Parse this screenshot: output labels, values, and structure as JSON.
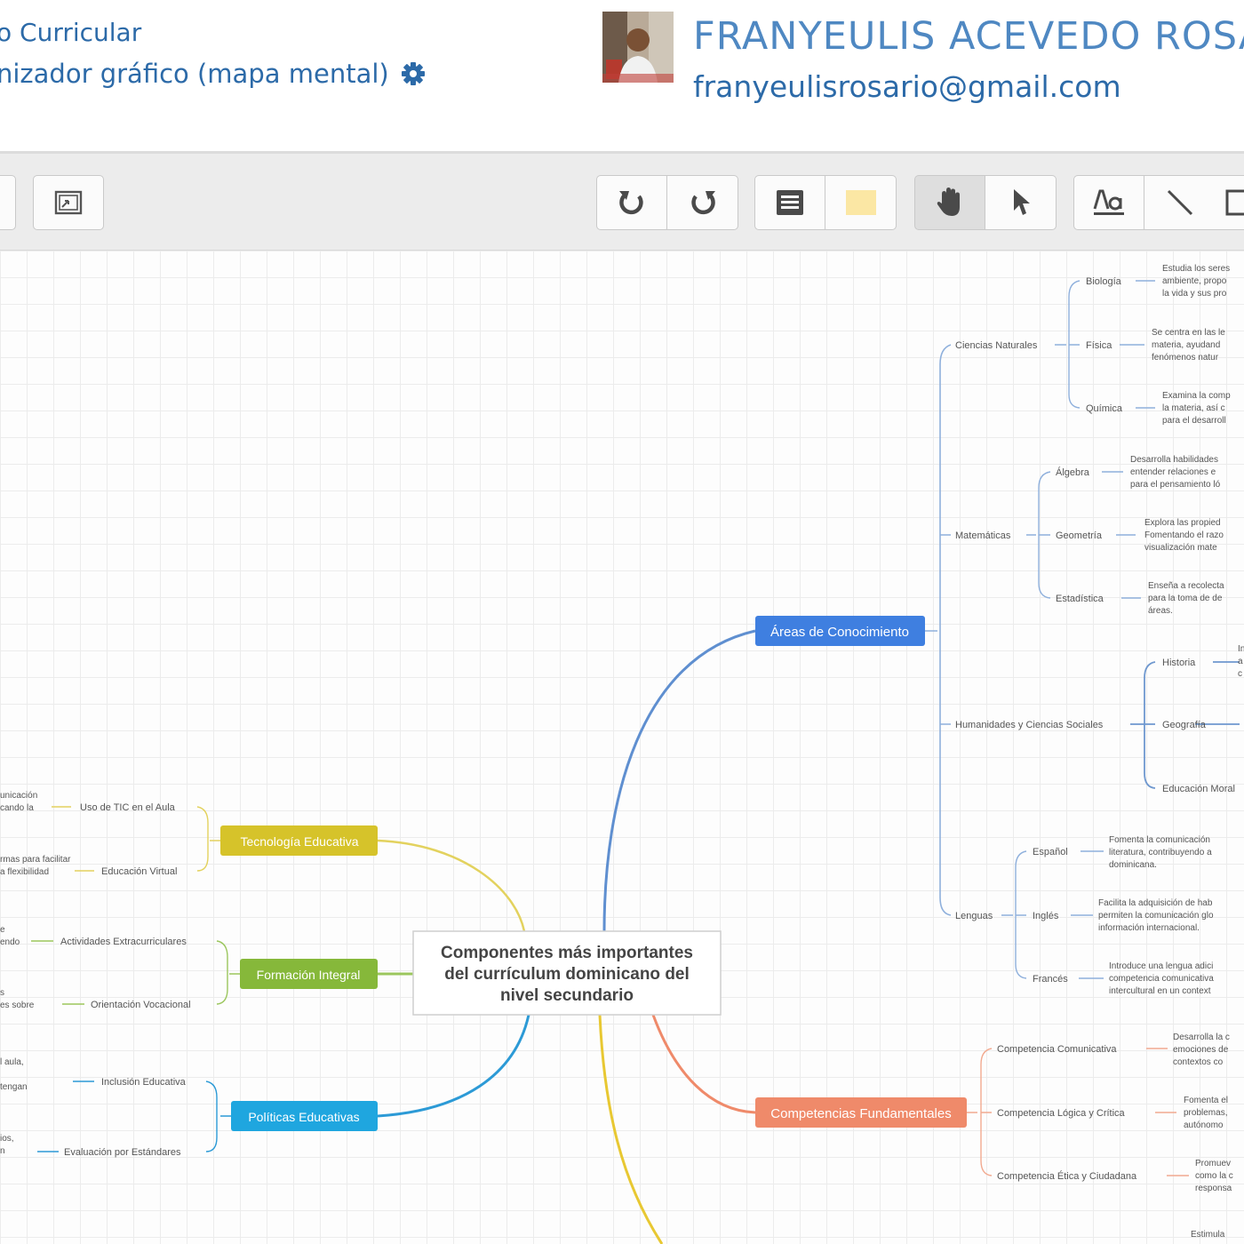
{
  "header": {
    "breadcrumb": "o Curricular",
    "activity_title": "nizador gráfico (mapa mental)",
    "user_name": "FRANYEULIS ACEVEDO ROSARIO",
    "user_email": "franyeulisrosario@gmail.com",
    "settings_icon": "gear-icon",
    "avatar_icon": "user-photo"
  },
  "toolbar": {
    "buttons": [
      {
        "icon": "collapse-icon"
      },
      {
        "icon": "fit-screen-icon"
      },
      {
        "icon": "undo-icon"
      },
      {
        "icon": "redo-icon"
      },
      {
        "icon": "note-icon"
      },
      {
        "icon": "color-fill-icon"
      },
      {
        "icon": "hand-pan-icon",
        "active": true
      },
      {
        "icon": "pointer-icon"
      },
      {
        "icon": "text-icon"
      },
      {
        "icon": "line-icon"
      },
      {
        "icon": "rectangle-icon"
      }
    ]
  },
  "mindmap": {
    "central": [
      "Componentes más importantes",
      "del currículum dominicano del",
      "nivel secundario"
    ],
    "colors": {
      "areas": "#3f7fe0",
      "competencias": "#ef8a6a",
      "tecnologia": "#d6c32a",
      "formacion": "#86b83a",
      "politicas": "#1fa6df"
    },
    "areas": {
      "label": "Áreas de Conocimiento",
      "ciencias": {
        "label": "Ciencias Naturales",
        "items": [
          {
            "label": "Biología",
            "desc": [
              "Estudia los seres",
              "ambiente, propo",
              "la vida y sus pro"
            ]
          },
          {
            "label": "Física",
            "desc": [
              "Se centra en las le",
              "materia, ayudand",
              "fenómenos natur"
            ]
          },
          {
            "label": "Química",
            "desc": [
              "Examina la comp",
              "la materia, así c",
              "para el desarroll"
            ]
          }
        ]
      },
      "matematicas": {
        "label": "Matemáticas",
        "items": [
          {
            "label": "Álgebra",
            "desc": [
              "Desarrolla habilidades",
              "entender relaciones e",
              "para el pensamiento ló"
            ]
          },
          {
            "label": "Geometría",
            "desc": [
              "Explora las propied",
              "Fomentando el razo",
              "visualización mate"
            ]
          },
          {
            "label": "Estadística",
            "desc": [
              "Enseña a recolecta",
              "para la toma de de",
              "áreas."
            ]
          }
        ]
      },
      "humanidades": {
        "label": "Humanidades y Ciencias Sociales",
        "items": [
          {
            "label": "Historia",
            "desc": [
              "In",
              "a",
              "c"
            ]
          },
          {
            "label": "Geografía",
            "desc": []
          },
          {
            "label": "Educación Moral",
            "desc": []
          }
        ]
      },
      "lenguas": {
        "label": "Lenguas",
        "items": [
          {
            "label": "Español",
            "desc": [
              "Fomenta la comunicación",
              "literatura, contribuyendo a",
              "dominicana."
            ]
          },
          {
            "label": "Inglés",
            "desc": [
              "Facilita la adquisición de hab",
              "permiten la comunicación glo",
              "información internacional."
            ]
          },
          {
            "label": "Francés",
            "desc": [
              "Introduce una lengua adici",
              "competencia comunicativa",
              "intercultural en un context"
            ]
          }
        ]
      }
    },
    "competencias": {
      "label": "Competencias Fundamentales",
      "items": [
        {
          "label": "Competencia Comunicativa",
          "desc": [
            "Desarrolla la c",
            "emociones de",
            "contextos co"
          ]
        },
        {
          "label": "Competencia Lógica y Crítica",
          "desc": [
            "Fomenta el",
            "problemas,",
            "autónomo"
          ]
        },
        {
          "label": "Competencia Ética y Ciudadana",
          "desc": [
            "Promuev",
            "como la c",
            "responsa"
          ]
        },
        {
          "label": "",
          "desc": [
            "Estimula"
          ]
        }
      ]
    },
    "tecnologia": {
      "label": "Tecnología Educativa",
      "items": [
        {
          "label": "Uso de TIC en el Aula",
          "desc": [
            "unicación",
            "cando la"
          ]
        },
        {
          "label": "Educación Virtual",
          "desc": [
            "rmas para facilitar",
            "a flexibilidad"
          ]
        }
      ]
    },
    "formacion": {
      "label": "Formación Integral",
      "items": [
        {
          "label": "Actividades Extracurriculares",
          "desc": [
            "e",
            "endo"
          ]
        },
        {
          "label": "Orientación Vocacional",
          "desc": [
            "s",
            "es sobre"
          ]
        }
      ]
    },
    "politicas": {
      "label": "Políticas Educativas",
      "items": [
        {
          "label": "Inclusión Educativa",
          "desc": [
            "l aula,",
            "tengan"
          ]
        },
        {
          "label": "Evaluación por Estándares",
          "desc": [
            "ios,",
            "n"
          ]
        }
      ]
    }
  }
}
